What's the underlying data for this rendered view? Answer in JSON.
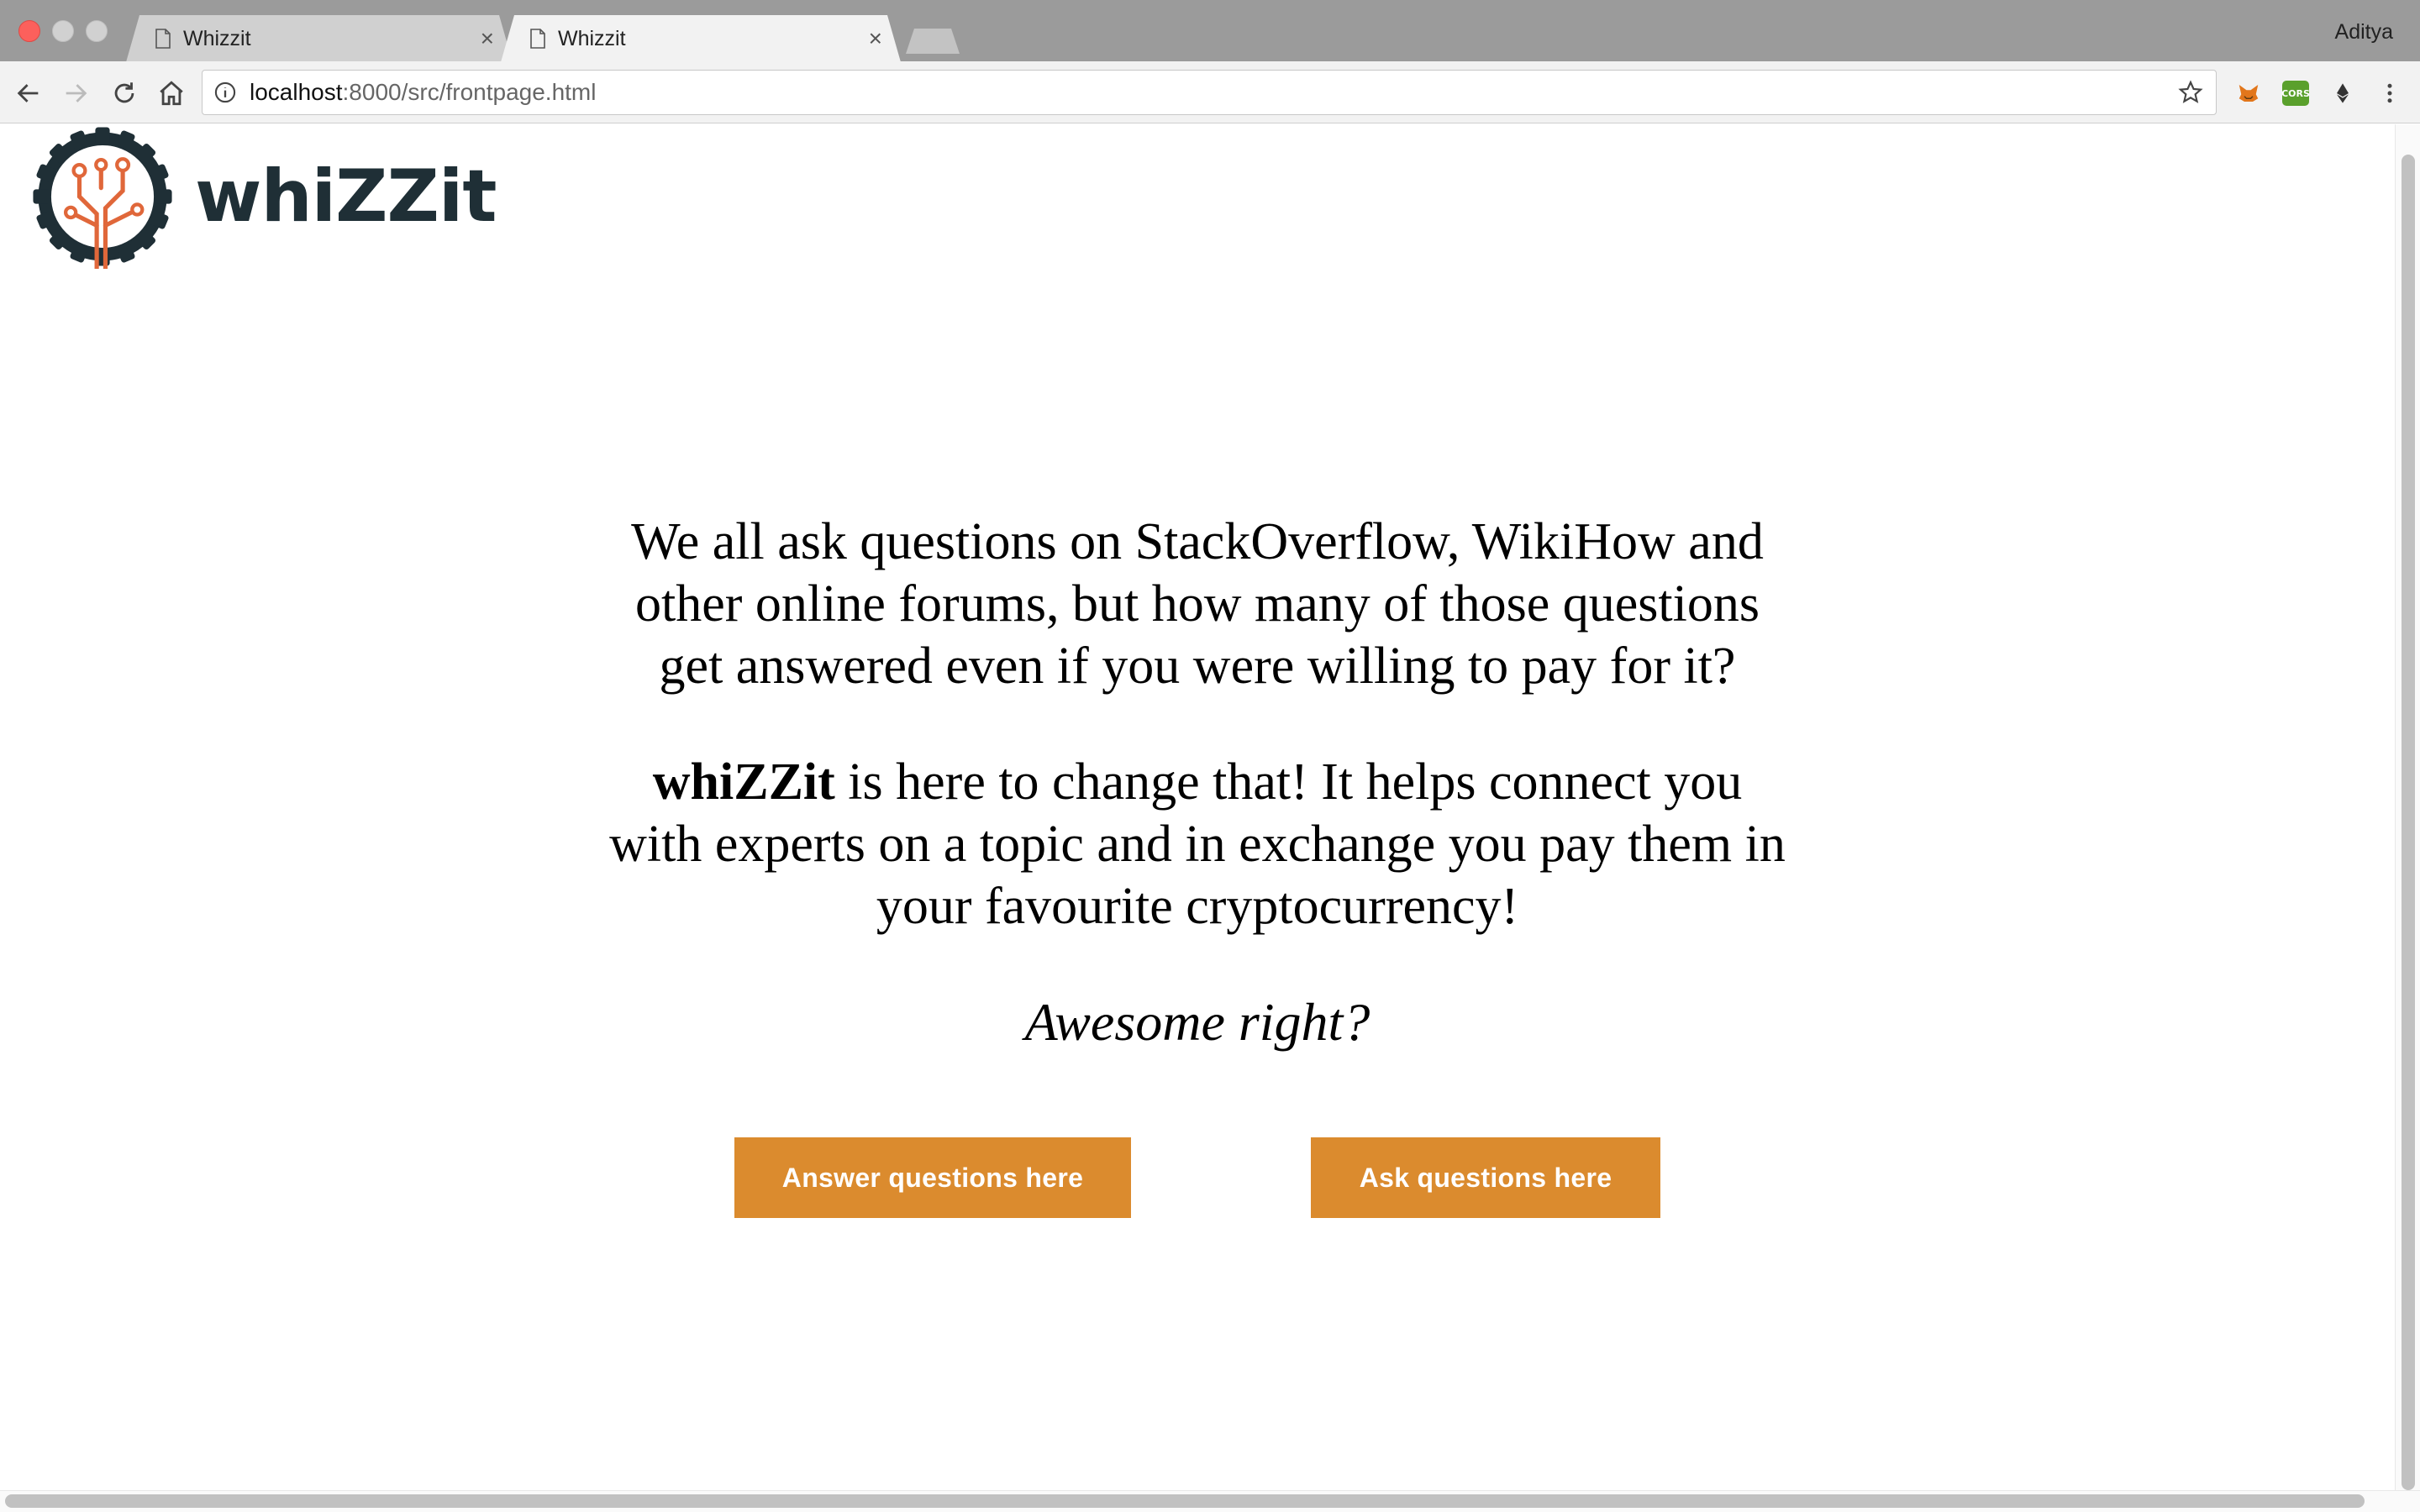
{
  "window": {
    "profile_name": "Aditya",
    "tabs": [
      {
        "title": "Whizzit",
        "active": false,
        "close": "×"
      },
      {
        "title": "Whizzit",
        "active": true,
        "close": "×"
      }
    ]
  },
  "toolbar": {
    "url_host": "localhost",
    "url_rest": ":8000/src/frontpage.html",
    "extensions": {
      "cors_label": "CORS"
    }
  },
  "page": {
    "logo_text": "whiZZit",
    "intro": "We all ask questions on StackOverflow, WikiHow and other online forums, but how many of those questions get answered even if you were willing to pay for it?",
    "pitch_brand": "whiZZit",
    "pitch_rest": " is here to change that! It helps connect you with experts on a topic and in exchange you pay them in your favourite cryptocurrency!",
    "tagline": "Awesome right?",
    "buttons": {
      "answer": "Answer questions here",
      "ask": "Ask questions here"
    }
  },
  "colors": {
    "accent": "#db8b2e",
    "logo_dark": "#1f2f36",
    "logo_orange": "#e0673a"
  }
}
